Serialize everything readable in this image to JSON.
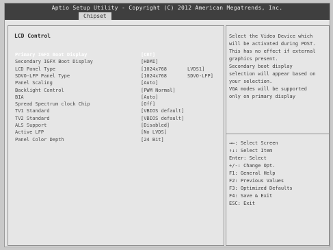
{
  "header": {
    "title": "Aptio Setup Utility - Copyright (C) 2012 American Megatrends, Inc.",
    "tab": "Chipset"
  },
  "main": {
    "section_title": "LCD Control",
    "rows": [
      {
        "label": "Primary IGFX Boot Display",
        "value": "[CRT]",
        "extra": "",
        "selected": true
      },
      {
        "label": "Secondary IGFX Boot Display",
        "value": "[HDMI]",
        "extra": ""
      },
      {
        "label": "LCD Panel Type",
        "value": "[1024x768",
        "extra": "LVDS1]"
      },
      {
        "label": "SDVO-LFP Panel Type",
        "value": "[1024x768",
        "extra": "SDVO-LFP]"
      },
      {
        "label": "Panel Scaling",
        "value": "[Auto]",
        "extra": ""
      },
      {
        "label": "Backlight Control",
        "value": "[PWM Normal]",
        "extra": ""
      },
      {
        "label": "BIA",
        "value": "[Auto]",
        "extra": ""
      },
      {
        "label": "Spread Spectrum clock Chip",
        "value": "[Off]",
        "extra": ""
      },
      {
        "label": "TV1 Standard",
        "value": "[VBIOS default]",
        "extra": ""
      },
      {
        "label": "TV2 Standard",
        "value": "[VBIOS default]",
        "extra": ""
      },
      {
        "label": "ALS Support",
        "value": "[Disabled]",
        "extra": ""
      },
      {
        "label": "Active LFP",
        "value": "[No LVDS]",
        "extra": ""
      },
      {
        "label": "Panel Color Depth",
        "value": "[24 Bit]",
        "extra": ""
      }
    ]
  },
  "help": {
    "text": "Select the Video Device which\nwill be activated during POST.\nThis has no effect if external\ngraphics present.\nSecondary boot display\nselection will appear based on\nyour selection.\nVGA modes will be supported\nonly on primary display"
  },
  "keys": [
    "→←: Select Screen",
    "↑↓: Select Item",
    "Enter: Select",
    "+/-: Change Opt.",
    "F1: General Help",
    "F2: Previous Values",
    "F3: Optimized Defaults",
    "F4: Save & Exit",
    "ESC: Exit"
  ]
}
